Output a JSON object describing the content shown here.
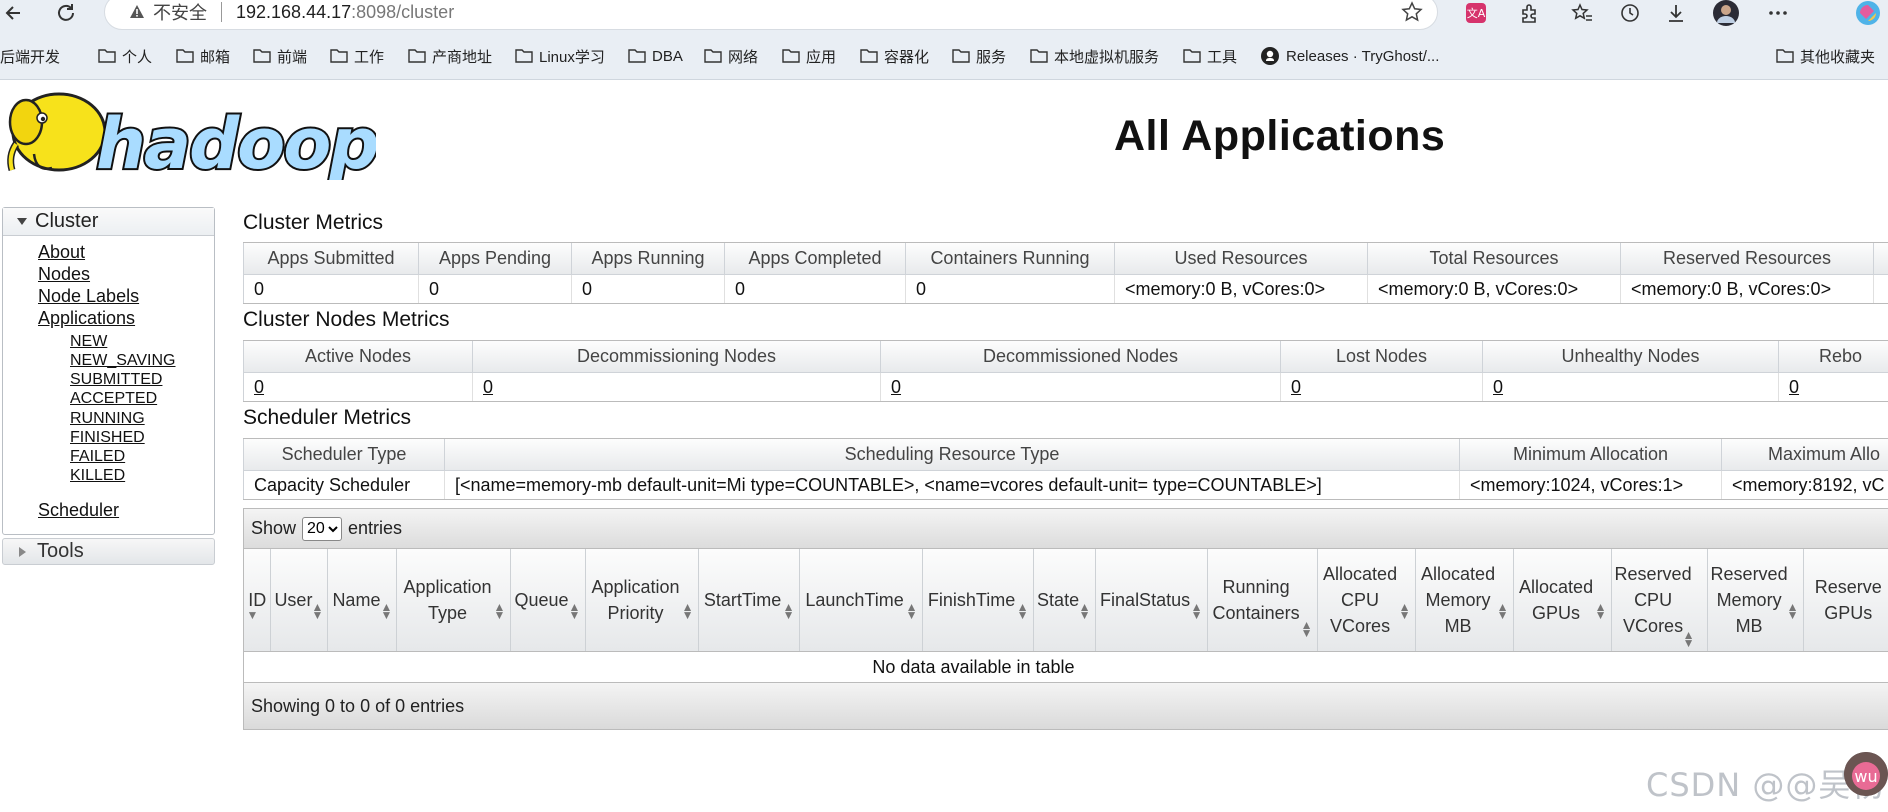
{
  "browser": {
    "security_label": "不安全",
    "url_host": "192.168.44.17",
    "url_rest": ":8098/cluster",
    "bookmarks": [
      "后端开发",
      "个人",
      "邮箱",
      "前端",
      "工作",
      "产商地址",
      "Linux学习",
      "DBA",
      "网络",
      "应用",
      "容器化",
      "服务",
      "本地虚拟机服务",
      "工具",
      "Releases · TryGhost/..."
    ],
    "other_bookmarks": "其他收藏夹"
  },
  "page": {
    "title": "All Applications"
  },
  "sidebar": {
    "cluster_label": "Cluster",
    "links": [
      "About",
      "Nodes",
      "Node Labels",
      "Applications"
    ],
    "app_states": [
      "NEW",
      "NEW_SAVING",
      "SUBMITTED",
      "ACCEPTED",
      "RUNNING",
      "FINISHED",
      "FAILED",
      "KILLED"
    ],
    "scheduler_label": "Scheduler",
    "tools_label": "Tools"
  },
  "cluster_metrics": {
    "title": "Cluster Metrics",
    "headers": [
      "Apps Submitted",
      "Apps Pending",
      "Apps Running",
      "Apps Completed",
      "Containers Running",
      "Used Resources",
      "Total Resources",
      "Reserved Resources"
    ],
    "values": [
      "0",
      "0",
      "0",
      "0",
      "0",
      "<memory:0 B, vCores:0>",
      "<memory:0 B, vCores:0>",
      "<memory:0 B, vCores:0>"
    ]
  },
  "node_metrics": {
    "title": "Cluster Nodes Metrics",
    "headers": [
      "Active Nodes",
      "Decommissioning Nodes",
      "Decommissioned Nodes",
      "Lost Nodes",
      "Unhealthy Nodes",
      "Rebo"
    ],
    "values": [
      "0",
      "0",
      "0",
      "0",
      "0",
      "0"
    ]
  },
  "scheduler_metrics": {
    "title": "Scheduler Metrics",
    "headers": [
      "Scheduler Type",
      "Scheduling Resource Type",
      "Minimum Allocation",
      "Maximum Allo"
    ],
    "values": [
      "Capacity Scheduler",
      "[<name=memory-mb default-unit=Mi type=COUNTABLE>, <name=vcores default-unit= type=COUNTABLE>]",
      "<memory:1024, vCores:1>",
      "<memory:8192, vC"
    ]
  },
  "apps_table": {
    "show_label": "Show",
    "entries_label": "entries",
    "page_size": "20",
    "columns": [
      "ID",
      "User",
      "Name",
      "Application Type",
      "Queue",
      "Application Priority",
      "StartTime",
      "LaunchTime",
      "FinishTime",
      "State",
      "FinalStatus",
      "Running Containers",
      "Allocated CPU VCores",
      "Allocated Memory MB",
      "Allocated GPUs",
      "Reserved CPU VCores",
      "Reserved Memory MB",
      "Reserve GPUs"
    ],
    "empty_text": "No data available in table",
    "footer_text": "Showing 0 to 0 of 0 entries"
  },
  "watermark": "CSDN @@吴杨"
}
